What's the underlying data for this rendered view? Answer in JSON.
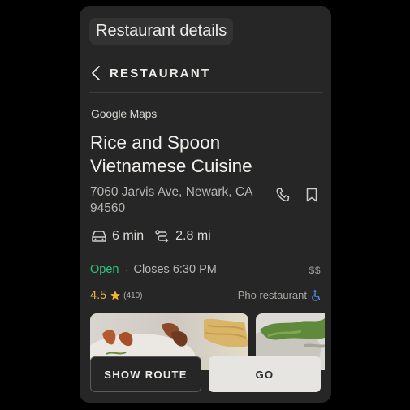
{
  "page": {
    "title": "Restaurant details"
  },
  "header": {
    "back_icon": "chevron-left-icon",
    "label": "RESTAURANT"
  },
  "source": {
    "label": "Google Maps"
  },
  "place": {
    "name": "Rice and Spoon Vietnamese Cuisine",
    "address": "7060 Jarvis Ave, Newark, CA 94560",
    "icons": [
      "phone-icon",
      "bookmark-icon"
    ]
  },
  "travel": {
    "drive_time": "6 min",
    "distance": "2.8 mi",
    "icons": [
      "car-icon",
      "route-icon"
    ]
  },
  "status": {
    "open": "Open",
    "separator": "·",
    "closes": "Closes 6:30 PM",
    "price": "$$",
    "open_color": "#2ec27e"
  },
  "rating": {
    "value": "4.5",
    "reviews": "(410)",
    "category": "Pho restaurant",
    "star_color": "#e6b24a",
    "accessibility_color": "#4a90e2"
  },
  "buttons": {
    "show_route": "SHOW ROUTE",
    "go": "GO"
  }
}
